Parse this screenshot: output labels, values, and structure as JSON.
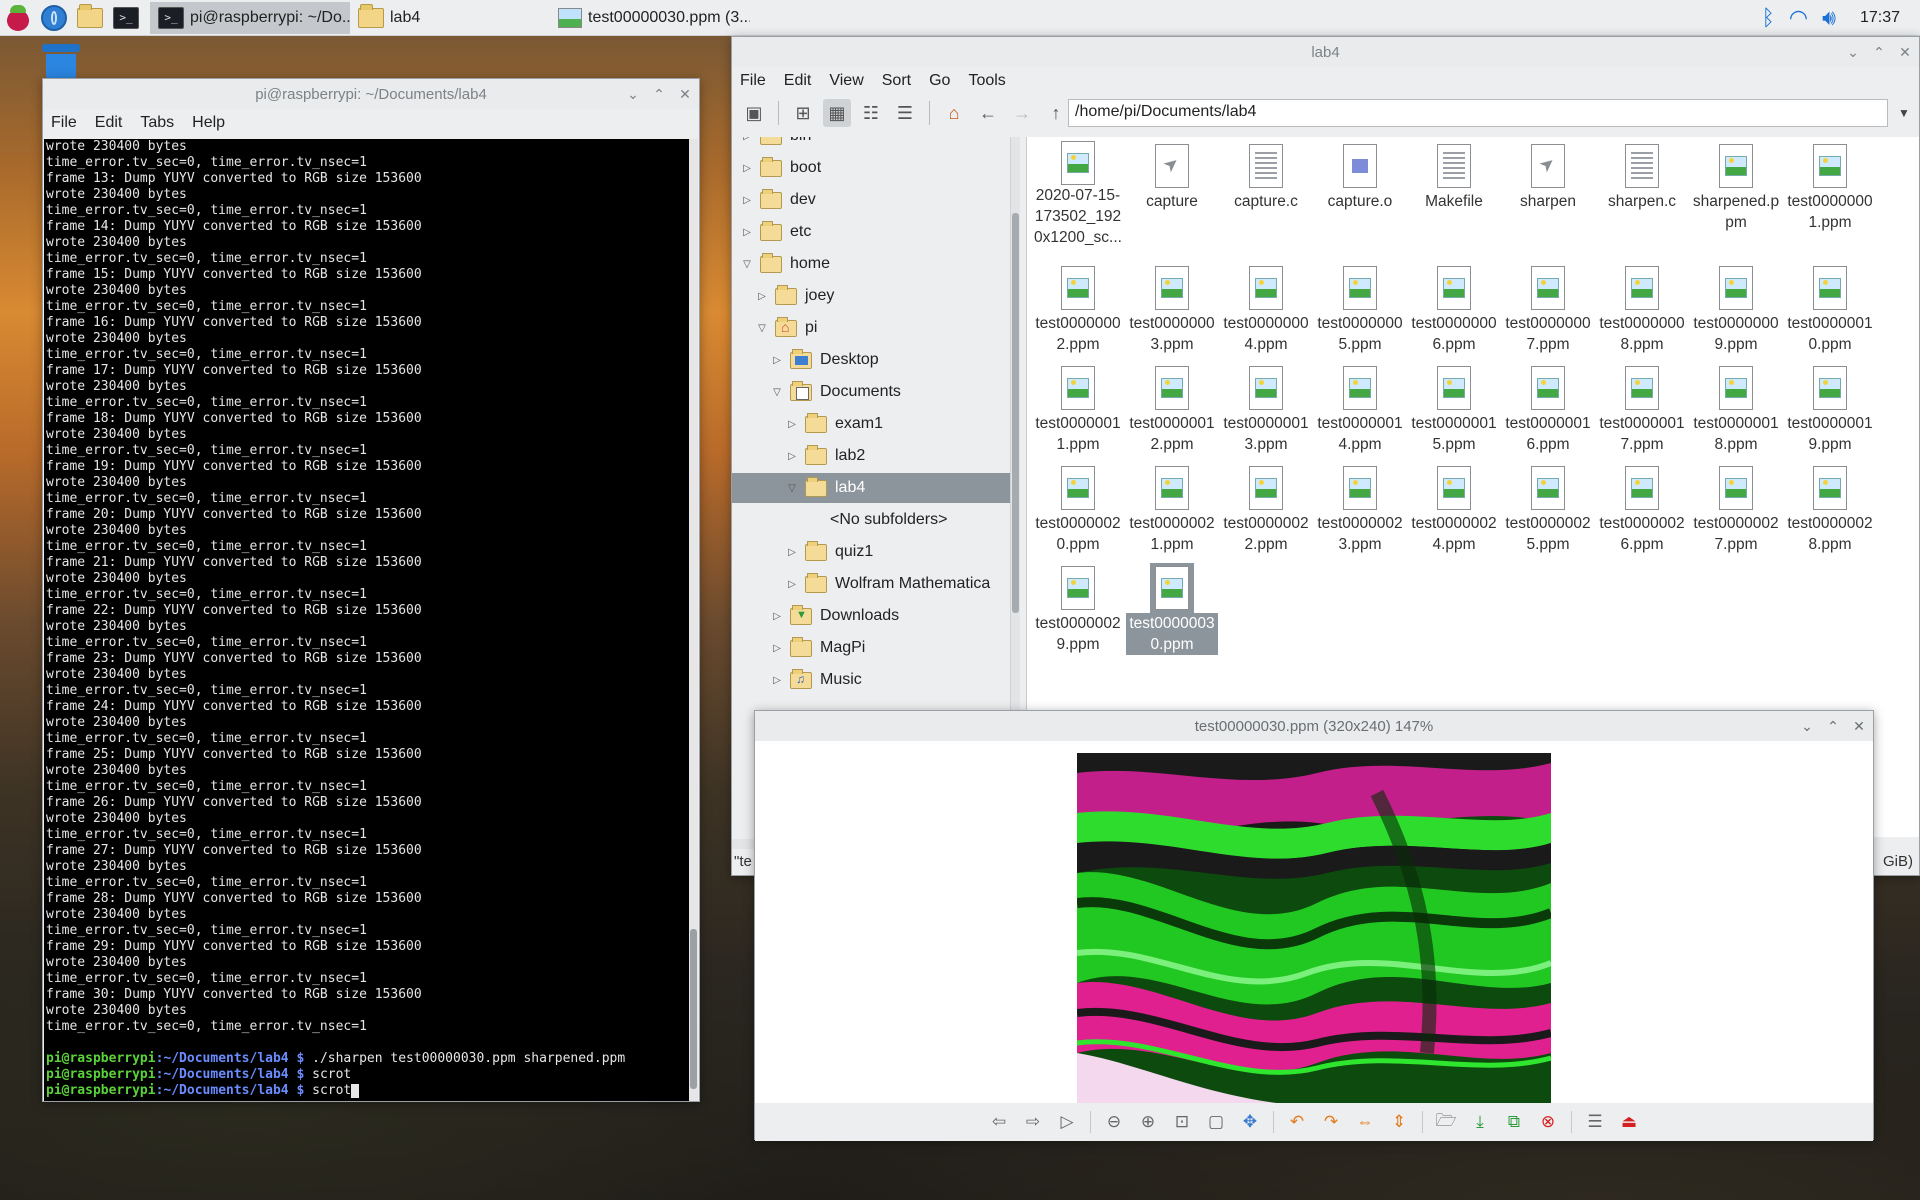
{
  "taskbar": {
    "tasks": [
      {
        "label": "pi@raspberrypi: ~/Do...",
        "active": true
      },
      {
        "label": "lab4",
        "active": false
      },
      {
        "label": "test00000030.ppm (3...",
        "active": false
      }
    ],
    "clock": "17:37"
  },
  "terminal": {
    "title": "pi@raspberrypi: ~/Documents/lab4",
    "menu": [
      "File",
      "Edit",
      "Tabs",
      "Help"
    ],
    "lines": [
      "wrote 230400 bytes",
      "time_error.tv_sec=0, time_error.tv_nsec=1",
      "frame 13: Dump YUYV converted to RGB size 153600",
      "wrote 230400 bytes",
      "time_error.tv_sec=0, time_error.tv_nsec=1",
      "frame 14: Dump YUYV converted to RGB size 153600",
      "wrote 230400 bytes",
      "time_error.tv_sec=0, time_error.tv_nsec=1",
      "frame 15: Dump YUYV converted to RGB size 153600",
      "wrote 230400 bytes",
      "time_error.tv_sec=0, time_error.tv_nsec=1",
      "frame 16: Dump YUYV converted to RGB size 153600",
      "wrote 230400 bytes",
      "time_error.tv_sec=0, time_error.tv_nsec=1",
      "frame 17: Dump YUYV converted to RGB size 153600",
      "wrote 230400 bytes",
      "time_error.tv_sec=0, time_error.tv_nsec=1",
      "frame 18: Dump YUYV converted to RGB size 153600",
      "wrote 230400 bytes",
      "time_error.tv_sec=0, time_error.tv_nsec=1",
      "frame 19: Dump YUYV converted to RGB size 153600",
      "wrote 230400 bytes",
      "time_error.tv_sec=0, time_error.tv_nsec=1",
      "frame 20: Dump YUYV converted to RGB size 153600",
      "wrote 230400 bytes",
      "time_error.tv_sec=0, time_error.tv_nsec=1",
      "frame 21: Dump YUYV converted to RGB size 153600",
      "wrote 230400 bytes",
      "time_error.tv_sec=0, time_error.tv_nsec=1",
      "frame 22: Dump YUYV converted to RGB size 153600",
      "wrote 230400 bytes",
      "time_error.tv_sec=0, time_error.tv_nsec=1",
      "frame 23: Dump YUYV converted to RGB size 153600",
      "wrote 230400 bytes",
      "time_error.tv_sec=0, time_error.tv_nsec=1",
      "frame 24: Dump YUYV converted to RGB size 153600",
      "wrote 230400 bytes",
      "time_error.tv_sec=0, time_error.tv_nsec=1",
      "frame 25: Dump YUYV converted to RGB size 153600",
      "wrote 230400 bytes",
      "time_error.tv_sec=0, time_error.tv_nsec=1",
      "frame 26: Dump YUYV converted to RGB size 153600",
      "wrote 230400 bytes",
      "time_error.tv_sec=0, time_error.tv_nsec=1",
      "frame 27: Dump YUYV converted to RGB size 153600",
      "wrote 230400 bytes",
      "time_error.tv_sec=0, time_error.tv_nsec=1",
      "frame 28: Dump YUYV converted to RGB size 153600",
      "wrote 230400 bytes",
      "time_error.tv_sec=0, time_error.tv_nsec=1",
      "frame 29: Dump YUYV converted to RGB size 153600",
      "wrote 230400 bytes",
      "time_error.tv_sec=0, time_error.tv_nsec=1",
      "frame 30: Dump YUYV converted to RGB size 153600",
      "wrote 230400 bytes",
      "time_error.tv_sec=0, time_error.tv_nsec=1",
      ""
    ],
    "prompt_user": "pi@raspberrypi",
    "prompt_path": ":~/Documents/lab4 $",
    "commands": [
      "./sharpen test00000030.ppm sharpened.ppm",
      "scrot",
      "scrot"
    ]
  },
  "filemanager": {
    "title": "lab4",
    "menu": [
      "File",
      "Edit",
      "View",
      "Sort",
      "Go",
      "Tools"
    ],
    "path": "/home/pi/Documents/lab4",
    "tree": [
      {
        "label": "bin",
        "level": 1,
        "arrow": "right",
        "icon": "folder"
      },
      {
        "label": "boot",
        "level": 1,
        "arrow": "right",
        "icon": "folder"
      },
      {
        "label": "dev",
        "level": 1,
        "arrow": "right",
        "icon": "folder"
      },
      {
        "label": "etc",
        "level": 1,
        "arrow": "right",
        "icon": "folder"
      },
      {
        "label": "home",
        "level": 1,
        "arrow": "down",
        "icon": "folder"
      },
      {
        "label": "joey",
        "level": 2,
        "arrow": "right",
        "icon": "folder"
      },
      {
        "label": "pi",
        "level": 2,
        "arrow": "down",
        "icon": "home"
      },
      {
        "label": "Desktop",
        "level": 3,
        "arrow": "right",
        "icon": "desk"
      },
      {
        "label": "Documents",
        "level": 3,
        "arrow": "down",
        "icon": "docs"
      },
      {
        "label": "exam1",
        "level": 4,
        "arrow": "right",
        "icon": "folder"
      },
      {
        "label": "lab2",
        "level": 4,
        "arrow": "right",
        "icon": "folder"
      },
      {
        "label": "lab4",
        "level": 4,
        "arrow": "down",
        "icon": "folder",
        "selected": true
      },
      {
        "label": "<No subfolders>",
        "level": 5,
        "arrow": "none",
        "icon": "none"
      },
      {
        "label": "quiz1",
        "level": 4,
        "arrow": "right",
        "icon": "folder"
      },
      {
        "label": "Wolfram Mathematica",
        "level": 4,
        "arrow": "right",
        "icon": "folder"
      },
      {
        "label": "Downloads",
        "level": 3,
        "arrow": "right",
        "icon": "down"
      },
      {
        "label": "MagPi",
        "level": 3,
        "arrow": "right",
        "icon": "folder"
      },
      {
        "label": "Music",
        "level": 3,
        "arrow": "right",
        "icon": "music"
      }
    ],
    "files": [
      {
        "name": "2020-07-15-173502_1920x1200_sc...",
        "icon": "img"
      },
      {
        "name": "capture",
        "icon": "exec"
      },
      {
        "name": "capture.c",
        "icon": "text"
      },
      {
        "name": "capture.o",
        "icon": "obj"
      },
      {
        "name": "Makefile",
        "icon": "text"
      },
      {
        "name": "sharpen",
        "icon": "exec"
      },
      {
        "name": "sharpen.c",
        "icon": "text"
      },
      {
        "name": "sharpened.ppm",
        "icon": "img"
      },
      {
        "name": "test00000001.ppm",
        "icon": "img"
      },
      {
        "name": "test00000002.ppm",
        "icon": "img"
      },
      {
        "name": "test00000003.ppm",
        "icon": "img"
      },
      {
        "name": "test00000004.ppm",
        "icon": "img"
      },
      {
        "name": "test00000005.ppm",
        "icon": "img"
      },
      {
        "name": "test00000006.ppm",
        "icon": "img"
      },
      {
        "name": "test00000007.ppm",
        "icon": "img"
      },
      {
        "name": "test00000008.ppm",
        "icon": "img"
      },
      {
        "name": "test00000009.ppm",
        "icon": "img"
      },
      {
        "name": "test00000010.ppm",
        "icon": "img"
      },
      {
        "name": "test00000011.ppm",
        "icon": "img"
      },
      {
        "name": "test00000012.ppm",
        "icon": "img"
      },
      {
        "name": "test00000013.ppm",
        "icon": "img"
      },
      {
        "name": "test00000014.ppm",
        "icon": "img"
      },
      {
        "name": "test00000015.ppm",
        "icon": "img"
      },
      {
        "name": "test00000016.ppm",
        "icon": "img"
      },
      {
        "name": "test00000017.ppm",
        "icon": "img"
      },
      {
        "name": "test00000018.ppm",
        "icon": "img"
      },
      {
        "name": "test00000019.ppm",
        "icon": "img"
      },
      {
        "name": "test00000020.ppm",
        "icon": "img"
      },
      {
        "name": "test00000021.ppm",
        "icon": "img"
      },
      {
        "name": "test00000022.ppm",
        "icon": "img"
      },
      {
        "name": "test00000023.ppm",
        "icon": "img"
      },
      {
        "name": "test00000024.ppm",
        "icon": "img"
      },
      {
        "name": "test00000025.ppm",
        "icon": "img"
      },
      {
        "name": "test00000026.ppm",
        "icon": "img"
      },
      {
        "name": "test00000027.ppm",
        "icon": "img"
      },
      {
        "name": "test00000028.ppm",
        "icon": "img"
      },
      {
        "name": "test00000029.ppm",
        "icon": "img"
      },
      {
        "name": "test00000030.ppm",
        "icon": "img",
        "selected": true
      }
    ],
    "status_left": "\"te",
    "status_right": "GiB)"
  },
  "viewer": {
    "title": "test00000030.ppm (320x240) 147%"
  }
}
